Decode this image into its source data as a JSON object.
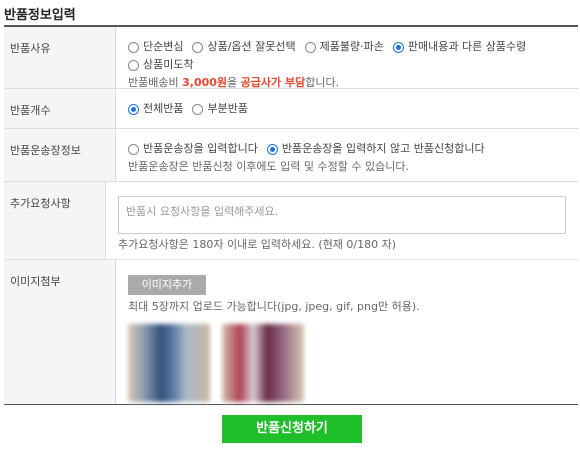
{
  "title": "반품정보입력",
  "reason": {
    "label": "반품사유",
    "options": [
      "단순변심",
      "상품/옵션 잘못선택",
      "제품불량·파손",
      "판매내용과 다른 상품수령",
      "상품미도착"
    ],
    "selected": "판매내용과 다른 상품수령",
    "note_pre": "반품배송비 ",
    "note_amount": "3,000원",
    "note_mid": "을 ",
    "note_payer": "공급사가 부담",
    "note_post": "합니다."
  },
  "count": {
    "label": "반품개수",
    "options": [
      "전체반품",
      "부분반품"
    ],
    "selected": "전체반품"
  },
  "tracking": {
    "label": "반품운송장정보",
    "options": [
      "반품운송장을 입력합니다",
      "반품운송장을 입력하지 않고 반품신청합니다"
    ],
    "selected": "반품운송장을 입력하지 않고 반품신청합니다",
    "note": "반품운송장은 반품신청 이후에도 입력 및 수정할 수 있습니다."
  },
  "extra": {
    "label": "추가요청사항",
    "placeholder": "반품시 요청사항을 입력해주세요.",
    "note": "추가요청사항은 180자 이내로 입력하세요. (현재 0/180 자)"
  },
  "attach": {
    "label": "이미지첨부",
    "button": "이미지추가",
    "note": "최대 5장까지 업로드 가능합니다(jpg, jpeg, gif, png만 허용)."
  },
  "submit_label": "반품신청하기",
  "colors": {
    "accent_radio": "#1a73e8",
    "submit_bg": "#1fbf2a",
    "highlight": "#e8472c"
  }
}
